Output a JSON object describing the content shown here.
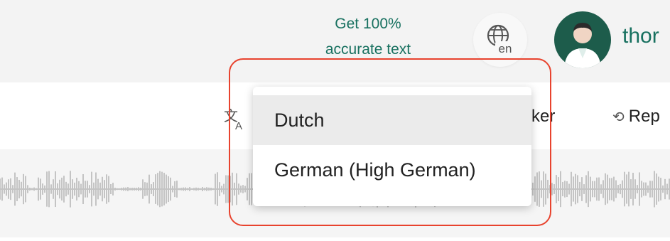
{
  "header": {
    "promo_line1": "Get 100%",
    "promo_line2": "accurate text",
    "language_button_code": "en",
    "username": "thor"
  },
  "toolbar": {
    "speaker_label_partial": "cker",
    "replace_label_partial": "Rep"
  },
  "language_dropdown": {
    "options": [
      {
        "label": "Dutch",
        "highlighted": true
      },
      {
        "label": "German (High German)",
        "highlighted": false
      }
    ]
  },
  "icons": {
    "language": "globe-icon",
    "translate": "translate-icon",
    "replace": "replace-icon",
    "avatar": "user-avatar-icon"
  },
  "colors": {
    "brand_green": "#17705f",
    "avatar_bg": "#1d5c4b",
    "annotation_red": "#e8432e",
    "waveform_gray": "#c4c4c4"
  }
}
